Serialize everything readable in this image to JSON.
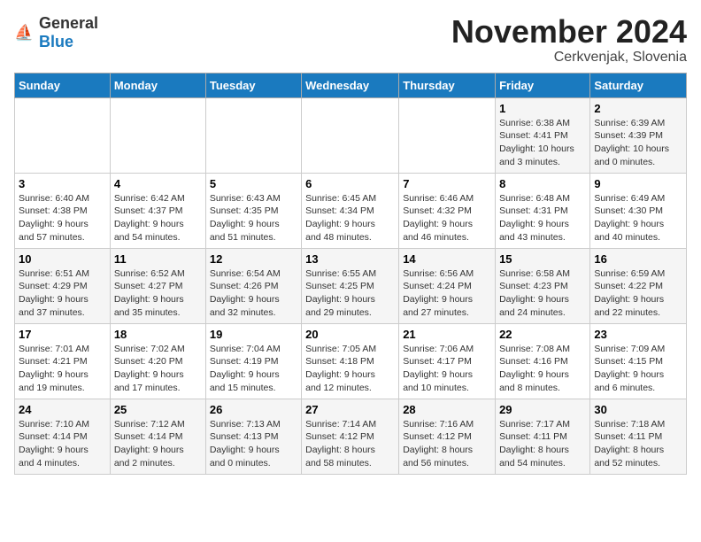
{
  "logo": {
    "general": "General",
    "blue": "Blue"
  },
  "header": {
    "title": "November 2024",
    "subtitle": "Cerkvenjak, Slovenia"
  },
  "weekdays": [
    "Sunday",
    "Monday",
    "Tuesday",
    "Wednesday",
    "Thursday",
    "Friday",
    "Saturday"
  ],
  "weeks": [
    [
      {
        "day": "",
        "info": ""
      },
      {
        "day": "",
        "info": ""
      },
      {
        "day": "",
        "info": ""
      },
      {
        "day": "",
        "info": ""
      },
      {
        "day": "",
        "info": ""
      },
      {
        "day": "1",
        "info": "Sunrise: 6:38 AM\nSunset: 4:41 PM\nDaylight: 10 hours\nand 3 minutes."
      },
      {
        "day": "2",
        "info": "Sunrise: 6:39 AM\nSunset: 4:39 PM\nDaylight: 10 hours\nand 0 minutes."
      }
    ],
    [
      {
        "day": "3",
        "info": "Sunrise: 6:40 AM\nSunset: 4:38 PM\nDaylight: 9 hours\nand 57 minutes."
      },
      {
        "day": "4",
        "info": "Sunrise: 6:42 AM\nSunset: 4:37 PM\nDaylight: 9 hours\nand 54 minutes."
      },
      {
        "day": "5",
        "info": "Sunrise: 6:43 AM\nSunset: 4:35 PM\nDaylight: 9 hours\nand 51 minutes."
      },
      {
        "day": "6",
        "info": "Sunrise: 6:45 AM\nSunset: 4:34 PM\nDaylight: 9 hours\nand 48 minutes."
      },
      {
        "day": "7",
        "info": "Sunrise: 6:46 AM\nSunset: 4:32 PM\nDaylight: 9 hours\nand 46 minutes."
      },
      {
        "day": "8",
        "info": "Sunrise: 6:48 AM\nSunset: 4:31 PM\nDaylight: 9 hours\nand 43 minutes."
      },
      {
        "day": "9",
        "info": "Sunrise: 6:49 AM\nSunset: 4:30 PM\nDaylight: 9 hours\nand 40 minutes."
      }
    ],
    [
      {
        "day": "10",
        "info": "Sunrise: 6:51 AM\nSunset: 4:29 PM\nDaylight: 9 hours\nand 37 minutes."
      },
      {
        "day": "11",
        "info": "Sunrise: 6:52 AM\nSunset: 4:27 PM\nDaylight: 9 hours\nand 35 minutes."
      },
      {
        "day": "12",
        "info": "Sunrise: 6:54 AM\nSunset: 4:26 PM\nDaylight: 9 hours\nand 32 minutes."
      },
      {
        "day": "13",
        "info": "Sunrise: 6:55 AM\nSunset: 4:25 PM\nDaylight: 9 hours\nand 29 minutes."
      },
      {
        "day": "14",
        "info": "Sunrise: 6:56 AM\nSunset: 4:24 PM\nDaylight: 9 hours\nand 27 minutes."
      },
      {
        "day": "15",
        "info": "Sunrise: 6:58 AM\nSunset: 4:23 PM\nDaylight: 9 hours\nand 24 minutes."
      },
      {
        "day": "16",
        "info": "Sunrise: 6:59 AM\nSunset: 4:22 PM\nDaylight: 9 hours\nand 22 minutes."
      }
    ],
    [
      {
        "day": "17",
        "info": "Sunrise: 7:01 AM\nSunset: 4:21 PM\nDaylight: 9 hours\nand 19 minutes."
      },
      {
        "day": "18",
        "info": "Sunrise: 7:02 AM\nSunset: 4:20 PM\nDaylight: 9 hours\nand 17 minutes."
      },
      {
        "day": "19",
        "info": "Sunrise: 7:04 AM\nSunset: 4:19 PM\nDaylight: 9 hours\nand 15 minutes."
      },
      {
        "day": "20",
        "info": "Sunrise: 7:05 AM\nSunset: 4:18 PM\nDaylight: 9 hours\nand 12 minutes."
      },
      {
        "day": "21",
        "info": "Sunrise: 7:06 AM\nSunset: 4:17 PM\nDaylight: 9 hours\nand 10 minutes."
      },
      {
        "day": "22",
        "info": "Sunrise: 7:08 AM\nSunset: 4:16 PM\nDaylight: 9 hours\nand 8 minutes."
      },
      {
        "day": "23",
        "info": "Sunrise: 7:09 AM\nSunset: 4:15 PM\nDaylight: 9 hours\nand 6 minutes."
      }
    ],
    [
      {
        "day": "24",
        "info": "Sunrise: 7:10 AM\nSunset: 4:14 PM\nDaylight: 9 hours\nand 4 minutes."
      },
      {
        "day": "25",
        "info": "Sunrise: 7:12 AM\nSunset: 4:14 PM\nDaylight: 9 hours\nand 2 minutes."
      },
      {
        "day": "26",
        "info": "Sunrise: 7:13 AM\nSunset: 4:13 PM\nDaylight: 9 hours\nand 0 minutes."
      },
      {
        "day": "27",
        "info": "Sunrise: 7:14 AM\nSunset: 4:12 PM\nDaylight: 8 hours\nand 58 minutes."
      },
      {
        "day": "28",
        "info": "Sunrise: 7:16 AM\nSunset: 4:12 PM\nDaylight: 8 hours\nand 56 minutes."
      },
      {
        "day": "29",
        "info": "Sunrise: 7:17 AM\nSunset: 4:11 PM\nDaylight: 8 hours\nand 54 minutes."
      },
      {
        "day": "30",
        "info": "Sunrise: 7:18 AM\nSunset: 4:11 PM\nDaylight: 8 hours\nand 52 minutes."
      }
    ]
  ]
}
